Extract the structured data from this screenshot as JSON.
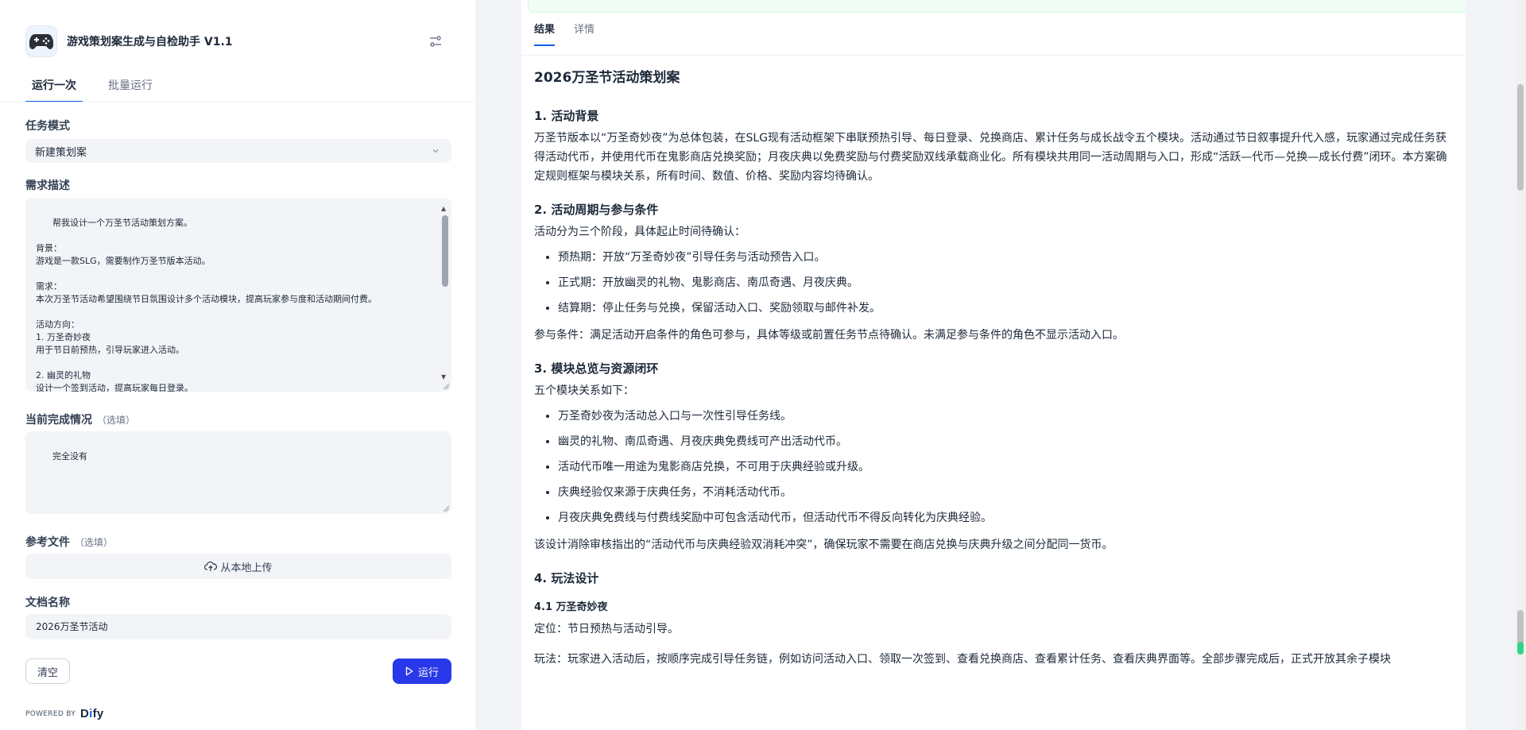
{
  "app": {
    "title": "游戏策划案生成与自检助手 V1.1",
    "icon": "gamepad-icon"
  },
  "left_tabs": [
    "运行一次",
    "批量运行"
  ],
  "form": {
    "task_mode_label": "任务模式",
    "task_mode_value": "新建策划案",
    "requirement_label": "需求描述",
    "requirement_value": "帮我设计一个万圣节活动策划方案。\n\n背景：\n游戏是一款SLG，需要制作万圣节版本活动。\n\n需求：\n本次万圣节活动希望围绕节日氛围设计多个活动模块，提高玩家参与度和活动期间付费。\n\n活动方向：\n1. 万圣奇妙夜\n用于节日前预热，引导玩家进入活动。\n\n2. 幽灵的礼物\n设计一个签到活动，提高玩家每日登录。",
    "progress_label": "当前完成情况",
    "optional_tag": "（选填）",
    "progress_value": "完全没有",
    "reference_label": "参考文件",
    "upload_label": "从本地上传",
    "docname_label": "文档名称",
    "docname_value": "2026万圣节活动",
    "clear_label": "清空",
    "run_label": "运行"
  },
  "powered_by": "POWERED BY",
  "brand": {
    "pre": "D",
    "mid": "i",
    "post": "fy"
  },
  "right_tabs": [
    "结果",
    "详情"
  ],
  "doc": {
    "title": "2026万圣节活动策划案",
    "s1_title": "1. 活动背景",
    "s1_para": "万圣节版本以“万圣奇妙夜”为总体包装，在SLG现有活动框架下串联预热引导、每日登录、兑换商店、累计任务与成长战令五个模块。活动通过节日叙事提升代入感，玩家通过完成任务获得活动代币，并使用代币在鬼影商店兑换奖励；月夜庆典以免费奖励与付费奖励双线承载商业化。所有模块共用同一活动周期与入口，形成“活跃—代币—兑换—成长付费”闭环。本方案确定规则框架与模块关系，所有时间、数值、价格、奖励内容均待确认。",
    "s2_title": "2. 活动周期与参与条件",
    "s2_para": "活动分为三个阶段，具体起止时间待确认：",
    "s2_list": [
      "预热期：开放“万圣奇妙夜”引导任务与活动预告入口。",
      "正式期：开放幽灵的礼物、鬼影商店、南瓜奇遇、月夜庆典。",
      "结算期：停止任务与兑换，保留活动入口、奖励领取与邮件补发。"
    ],
    "s2_para2": "参与条件：满足活动开启条件的角色可参与，具体等级或前置任务节点待确认。未满足参与条件的角色不显示活动入口。",
    "s3_title": "3. 模块总览与资源闭环",
    "s3_para": "五个模块关系如下：",
    "s3_list": [
      "万圣奇妙夜为活动总入口与一次性引导任务线。",
      "幽灵的礼物、南瓜奇遇、月夜庆典免费线可产出活动代币。",
      "活动代币唯一用途为鬼影商店兑换，不可用于庆典经验或升级。",
      "庆典经验仅来源于庆典任务，不消耗活动代币。",
      "月夜庆典免费线与付费线奖励中可包含活动代币，但活动代币不得反向转化为庆典经验。"
    ],
    "s3_para2": "该设计消除审核指出的“活动代币与庆典经验双消耗冲突”，确保玩家不需要在商店兑换与庆典升级之间分配同一货币。",
    "s4_title": "4. 玩法设计",
    "s41_title": "4.1 万圣奇妙夜",
    "s41_para1": "定位：节日预热与活动引导。",
    "s41_para2": "玩法：玩家进入活动后，按顺序完成引导任务链，例如访问活动入口、领取一次签到、查看兑换商店、查看累计任务、查看庆典界面等。全部步骤完成后，正式开放其余子模块"
  }
}
